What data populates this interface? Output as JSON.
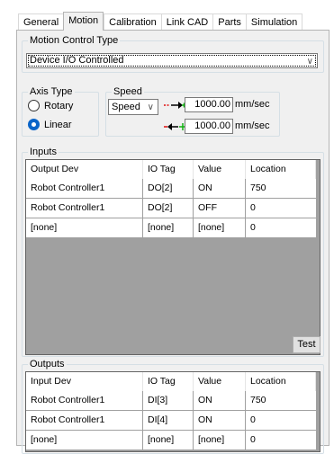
{
  "tabs": [
    {
      "label": "General",
      "active": false
    },
    {
      "label": "Motion",
      "active": true
    },
    {
      "label": "Calibration",
      "active": false
    },
    {
      "label": "Link CAD",
      "active": false
    },
    {
      "label": "Parts",
      "active": false
    },
    {
      "label": "Simulation",
      "active": false
    }
  ],
  "motion_control": {
    "group_label": "Motion Control Type",
    "selected": "Device I/O Controlled"
  },
  "axis_type": {
    "group_label": "Axis Type",
    "options": [
      {
        "label": "Rotary",
        "checked": false
      },
      {
        "label": "Linear",
        "checked": true
      }
    ]
  },
  "speed": {
    "group_label": "Speed",
    "mode_selected": "Speed",
    "forward_value": "1000.00",
    "reverse_value": "1000.00",
    "unit": "mm/sec"
  },
  "inputs": {
    "group_label": "Inputs",
    "columns": [
      "Output Dev",
      "IO Tag",
      "Value",
      "Location"
    ],
    "rows": [
      [
        "Robot Controller1",
        "DO[2]",
        "ON",
        "750"
      ],
      [
        "Robot Controller1",
        "DO[2]",
        "OFF",
        "0"
      ],
      [
        "[none]",
        "[none]",
        "[none]",
        "0"
      ]
    ]
  },
  "test_button": "Test",
  "outputs": {
    "group_label": "Outputs",
    "columns": [
      "Input Dev",
      "IO Tag",
      "Value",
      "Location"
    ],
    "rows": [
      [
        "Robot Controller1",
        "DI[3]",
        "ON",
        "750"
      ],
      [
        "Robot Controller1",
        "DI[4]",
        "ON",
        "0"
      ],
      [
        "[none]",
        "[none]",
        "[none]",
        "0"
      ]
    ]
  },
  "colors": {
    "panel_bg": "#f0f0f0",
    "radio_selected": "#0a64c8",
    "table_empty_area": "#a0a0a0",
    "arrow_red": "#e01010",
    "arrow_green": "#10b010"
  }
}
